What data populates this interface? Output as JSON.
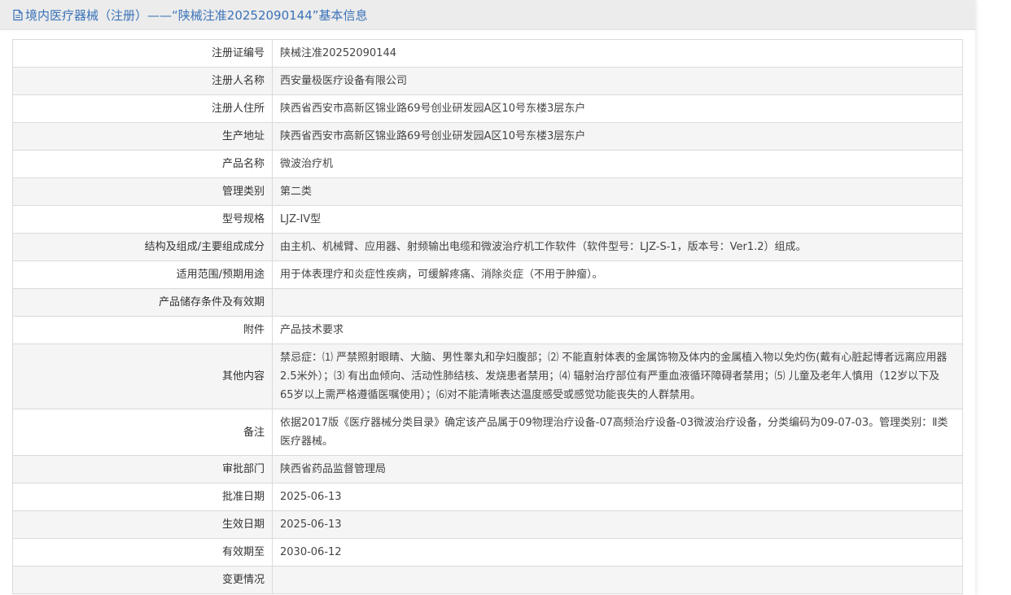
{
  "header": {
    "title": "境内医疗器械（注册）——“陕械注准20252090144”基本信息",
    "icon": "document-icon",
    "title_color": "#3b73b9"
  },
  "rows": [
    {
      "label": "注册证编号",
      "value": "陕械注准20252090144"
    },
    {
      "label": "注册人名称",
      "value": "西安量极医疗设备有限公司"
    },
    {
      "label": "注册人住所",
      "value": "陕西省西安市高新区锦业路69号创业研发园A区10号东楼3层东户"
    },
    {
      "label": "生产地址",
      "value": "陕西省西安市高新区锦业路69号创业研发园A区10号东楼3层东户"
    },
    {
      "label": "产品名称",
      "value": "微波治疗机"
    },
    {
      "label": "管理类别",
      "value": "第二类"
    },
    {
      "label": "型号规格",
      "value": "LJZ-IV型"
    },
    {
      "label": "结构及组成/主要组成成分",
      "value": "由主机、机械臂、应用器、射频输出电缆和微波治疗机工作软件（软件型号：LJZ-S-1，版本号：Ver1.2）组成。"
    },
    {
      "label": "适用范围/预期用途",
      "value": "用于体表理疗和炎症性疾病，可缓解疼痛、消除炎症（不用于肿瘤）。"
    },
    {
      "label": "产品储存条件及有效期",
      "value": ""
    },
    {
      "label": "附件",
      "value": "产品技术要求"
    },
    {
      "label": "其他内容",
      "value": "禁忌症：⑴ 严禁照射眼睛、大脑、男性睾丸和孕妇腹部；⑵ 不能直射体表的金属饰物及体内的金属植入物以免灼伤(戴有心脏起博者远离应用器2.5米外）；⑶ 有出血倾向、活动性肺结核、发烧患者禁用；⑷ 辐射治疗部位有严重血液循环障碍者禁用；⑸ 儿童及老年人慎用（12岁以下及65岁以上需严格遵循医嘱使用）；⑹对不能清晰表达温度感受或感觉功能丧失的人群禁用。"
    },
    {
      "label": "备注",
      "value": "依据2017版《医疗器械分类目录》确定该产品属于09物理治疗设备-07高频治疗设备-03微波治疗设备，分类编码为09-07-03。管理类别：Ⅱ类医疗器械。"
    },
    {
      "label": "审批部门",
      "value": "陕西省药品监督管理局"
    },
    {
      "label": "批准日期",
      "value": "2025-06-13"
    },
    {
      "label": "生效日期",
      "value": "2025-06-13"
    },
    {
      "label": "有效期至",
      "value": "2030-06-12"
    },
    {
      "label": "变更情况",
      "value": ""
    }
  ]
}
